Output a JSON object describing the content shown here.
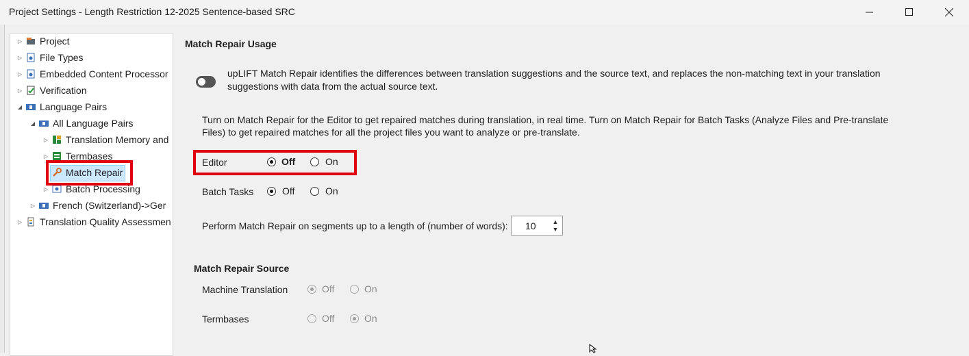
{
  "window": {
    "title": "Project Settings - Length Restriction 12-2025 Sentence-based SRC",
    "controls": [
      "minimize-icon",
      "maximize-icon",
      "close-icon"
    ]
  },
  "sidebar": {
    "items": [
      {
        "label": "Project",
        "icon": "project-icon"
      },
      {
        "label": "File Types",
        "icon": "file-types-icon"
      },
      {
        "label": "Embedded Content Processor",
        "icon": "gear-doc-icon"
      },
      {
        "label": "Verification",
        "icon": "verification-icon"
      },
      {
        "label": "Language Pairs",
        "icon": "language-pairs-icon"
      },
      {
        "label": "All Language Pairs",
        "icon": "language-pairs-icon"
      },
      {
        "label": "Translation Memory and",
        "icon": "translation-memory-icon"
      },
      {
        "label": "Termbases",
        "icon": "termbase-icon"
      },
      {
        "label": "Match Repair",
        "icon": "wrench-icon"
      },
      {
        "label": "Batch Processing",
        "icon": "batch-icon"
      },
      {
        "label": "French (Switzerland)->Ger",
        "icon": "language-pairs-icon"
      },
      {
        "label": "Translation Quality Assessmen",
        "icon": "tqa-icon"
      }
    ]
  },
  "usage": {
    "heading": "Match Repair Usage",
    "description_line1": "upLIFT Match Repair identifies the differences between translation suggestions and the source text, and replaces the non-matching text in your translation",
    "description_line2": "suggestions with data from the actual source text.",
    "toggle_on": false,
    "info_line1": "Turn on Match Repair for the Editor to get repaired matches during translation, in real time. Turn on Match Repair for Batch Tasks (Analyze Files and Pre-translate",
    "info_line2": "Files) to get repaired matches for all the project files you want to analyze or pre-translate.",
    "editor": {
      "label": "Editor",
      "off": "Off",
      "on": "On",
      "selected": "Off"
    },
    "batch": {
      "label": "Batch Tasks",
      "off": "Off",
      "on": "On",
      "selected": "Off"
    },
    "length_label": "Perform Match Repair on segments up to a length of (number of words):",
    "length_value": "10"
  },
  "source": {
    "heading": "Match Repair Source",
    "mt": {
      "label": "Machine Translation",
      "off": "Off",
      "on": "On",
      "selected": "Off"
    },
    "termbases": {
      "label": "Termbases",
      "off": "Off",
      "on": "On",
      "selected": "On"
    }
  },
  "colors": {
    "highlight_box": "#e0000e",
    "selection": "#cce8ff"
  }
}
